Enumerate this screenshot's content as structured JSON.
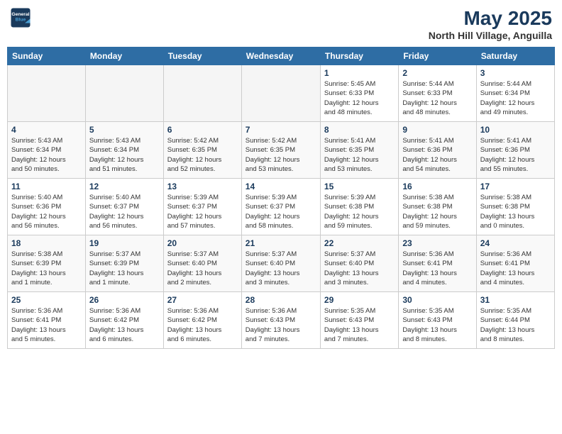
{
  "header": {
    "logo_line1": "General",
    "logo_line2": "Blue",
    "title": "May 2025",
    "subtitle": "North Hill Village, Anguilla"
  },
  "days_of_week": [
    "Sunday",
    "Monday",
    "Tuesday",
    "Wednesday",
    "Thursday",
    "Friday",
    "Saturday"
  ],
  "weeks": [
    [
      {
        "num": "",
        "info": ""
      },
      {
        "num": "",
        "info": ""
      },
      {
        "num": "",
        "info": ""
      },
      {
        "num": "",
        "info": ""
      },
      {
        "num": "1",
        "info": "Sunrise: 5:45 AM\nSunset: 6:33 PM\nDaylight: 12 hours\nand 48 minutes."
      },
      {
        "num": "2",
        "info": "Sunrise: 5:44 AM\nSunset: 6:33 PM\nDaylight: 12 hours\nand 48 minutes."
      },
      {
        "num": "3",
        "info": "Sunrise: 5:44 AM\nSunset: 6:34 PM\nDaylight: 12 hours\nand 49 minutes."
      }
    ],
    [
      {
        "num": "4",
        "info": "Sunrise: 5:43 AM\nSunset: 6:34 PM\nDaylight: 12 hours\nand 50 minutes."
      },
      {
        "num": "5",
        "info": "Sunrise: 5:43 AM\nSunset: 6:34 PM\nDaylight: 12 hours\nand 51 minutes."
      },
      {
        "num": "6",
        "info": "Sunrise: 5:42 AM\nSunset: 6:35 PM\nDaylight: 12 hours\nand 52 minutes."
      },
      {
        "num": "7",
        "info": "Sunrise: 5:42 AM\nSunset: 6:35 PM\nDaylight: 12 hours\nand 53 minutes."
      },
      {
        "num": "8",
        "info": "Sunrise: 5:41 AM\nSunset: 6:35 PM\nDaylight: 12 hours\nand 53 minutes."
      },
      {
        "num": "9",
        "info": "Sunrise: 5:41 AM\nSunset: 6:36 PM\nDaylight: 12 hours\nand 54 minutes."
      },
      {
        "num": "10",
        "info": "Sunrise: 5:41 AM\nSunset: 6:36 PM\nDaylight: 12 hours\nand 55 minutes."
      }
    ],
    [
      {
        "num": "11",
        "info": "Sunrise: 5:40 AM\nSunset: 6:36 PM\nDaylight: 12 hours\nand 56 minutes."
      },
      {
        "num": "12",
        "info": "Sunrise: 5:40 AM\nSunset: 6:37 PM\nDaylight: 12 hours\nand 56 minutes."
      },
      {
        "num": "13",
        "info": "Sunrise: 5:39 AM\nSunset: 6:37 PM\nDaylight: 12 hours\nand 57 minutes."
      },
      {
        "num": "14",
        "info": "Sunrise: 5:39 AM\nSunset: 6:37 PM\nDaylight: 12 hours\nand 58 minutes."
      },
      {
        "num": "15",
        "info": "Sunrise: 5:39 AM\nSunset: 6:38 PM\nDaylight: 12 hours\nand 59 minutes."
      },
      {
        "num": "16",
        "info": "Sunrise: 5:38 AM\nSunset: 6:38 PM\nDaylight: 12 hours\nand 59 minutes."
      },
      {
        "num": "17",
        "info": "Sunrise: 5:38 AM\nSunset: 6:38 PM\nDaylight: 13 hours\nand 0 minutes."
      }
    ],
    [
      {
        "num": "18",
        "info": "Sunrise: 5:38 AM\nSunset: 6:39 PM\nDaylight: 13 hours\nand 1 minute."
      },
      {
        "num": "19",
        "info": "Sunrise: 5:37 AM\nSunset: 6:39 PM\nDaylight: 13 hours\nand 1 minute."
      },
      {
        "num": "20",
        "info": "Sunrise: 5:37 AM\nSunset: 6:40 PM\nDaylight: 13 hours\nand 2 minutes."
      },
      {
        "num": "21",
        "info": "Sunrise: 5:37 AM\nSunset: 6:40 PM\nDaylight: 13 hours\nand 3 minutes."
      },
      {
        "num": "22",
        "info": "Sunrise: 5:37 AM\nSunset: 6:40 PM\nDaylight: 13 hours\nand 3 minutes."
      },
      {
        "num": "23",
        "info": "Sunrise: 5:36 AM\nSunset: 6:41 PM\nDaylight: 13 hours\nand 4 minutes."
      },
      {
        "num": "24",
        "info": "Sunrise: 5:36 AM\nSunset: 6:41 PM\nDaylight: 13 hours\nand 4 minutes."
      }
    ],
    [
      {
        "num": "25",
        "info": "Sunrise: 5:36 AM\nSunset: 6:41 PM\nDaylight: 13 hours\nand 5 minutes."
      },
      {
        "num": "26",
        "info": "Sunrise: 5:36 AM\nSunset: 6:42 PM\nDaylight: 13 hours\nand 6 minutes."
      },
      {
        "num": "27",
        "info": "Sunrise: 5:36 AM\nSunset: 6:42 PM\nDaylight: 13 hours\nand 6 minutes."
      },
      {
        "num": "28",
        "info": "Sunrise: 5:36 AM\nSunset: 6:43 PM\nDaylight: 13 hours\nand 7 minutes."
      },
      {
        "num": "29",
        "info": "Sunrise: 5:35 AM\nSunset: 6:43 PM\nDaylight: 13 hours\nand 7 minutes."
      },
      {
        "num": "30",
        "info": "Sunrise: 5:35 AM\nSunset: 6:43 PM\nDaylight: 13 hours\nand 8 minutes."
      },
      {
        "num": "31",
        "info": "Sunrise: 5:35 AM\nSunset: 6:44 PM\nDaylight: 13 hours\nand 8 minutes."
      }
    ]
  ]
}
